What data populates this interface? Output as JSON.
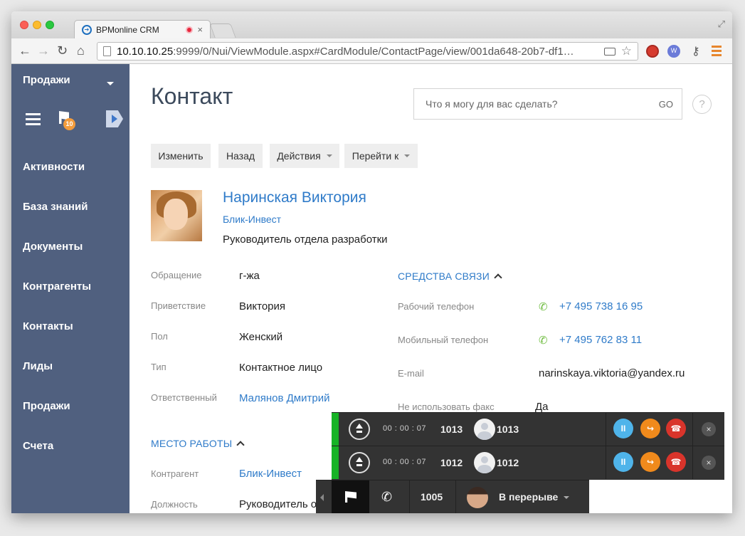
{
  "browser": {
    "tab_title": "BPMonline CRM",
    "tab_close": "×",
    "url_host": "10.10.10.25",
    "url_rest": ":9999/0/Nui/ViewModule.aspx#CardModule/ContactPage/view/001da648-20b7-df1…",
    "star": "☆",
    "ext_w_label": "W"
  },
  "sidebar": {
    "title": "Продажи",
    "badge": "10",
    "items": [
      "Активности",
      "База знаний",
      "Документы",
      "Контрагенты",
      "Контакты",
      "Лиды",
      "Продажи",
      "Счета"
    ]
  },
  "page": {
    "title": "Контакт",
    "search_placeholder": "Что я могу для вас сделать?",
    "search_go": "GO",
    "help": "?"
  },
  "actions": {
    "edit": "Изменить",
    "back": "Назад",
    "actions": "Действия",
    "goto": "Перейти к"
  },
  "contact": {
    "name": "Наринская Виктория",
    "company": "Блик-Инвест",
    "role": "Руководитель отдела разработки"
  },
  "fields": {
    "salutation_label": "Обращение",
    "salutation_value": "г-жа",
    "greeting_label": "Приветствие",
    "greeting_value": "Виктория",
    "gender_label": "Пол",
    "gender_value": "Женский",
    "type_label": "Тип",
    "type_value": "Контактное лицо",
    "owner_label": "Ответственный",
    "owner_value": "Малянов Дмитрий"
  },
  "comm": {
    "header": "СРЕДСТВА СВЯЗИ",
    "work_phone_label": "Рабочий телефон",
    "work_phone_value": "+7 495 738 16 95",
    "mobile_label": "Мобильный телефон",
    "mobile_value": "+7 495 762 83 11",
    "email_label": "E-mail",
    "email_value": "narinskaya.viktoria@yandex.ru",
    "nofax_label": "Не использовать факс",
    "nofax_value": "Да"
  },
  "work": {
    "header": "МЕСТО РАБОТЫ",
    "account_label": "Контрагент",
    "account_value": "Блик-Инвест",
    "position_label": "Должность",
    "position_value": "Руководитель о"
  },
  "calls": [
    {
      "time": "00 : 00 : 07",
      "number": "1013",
      "name": "1013"
    },
    {
      "time": "00 : 00 : 07",
      "number": "1012",
      "name": "1012"
    }
  ],
  "call_buttons": {
    "pause": "II",
    "transfer": "↪",
    "hangup": "☎",
    "close": "×"
  },
  "status_bar": {
    "extension": "1005",
    "status": "В перерыве"
  },
  "colors": {
    "sidebar": "#50607f",
    "link": "#2f7bc9",
    "call_active": "#17b326",
    "pause": "#4fb4ea",
    "transfer": "#f08a1c",
    "hangup": "#d9342b"
  }
}
